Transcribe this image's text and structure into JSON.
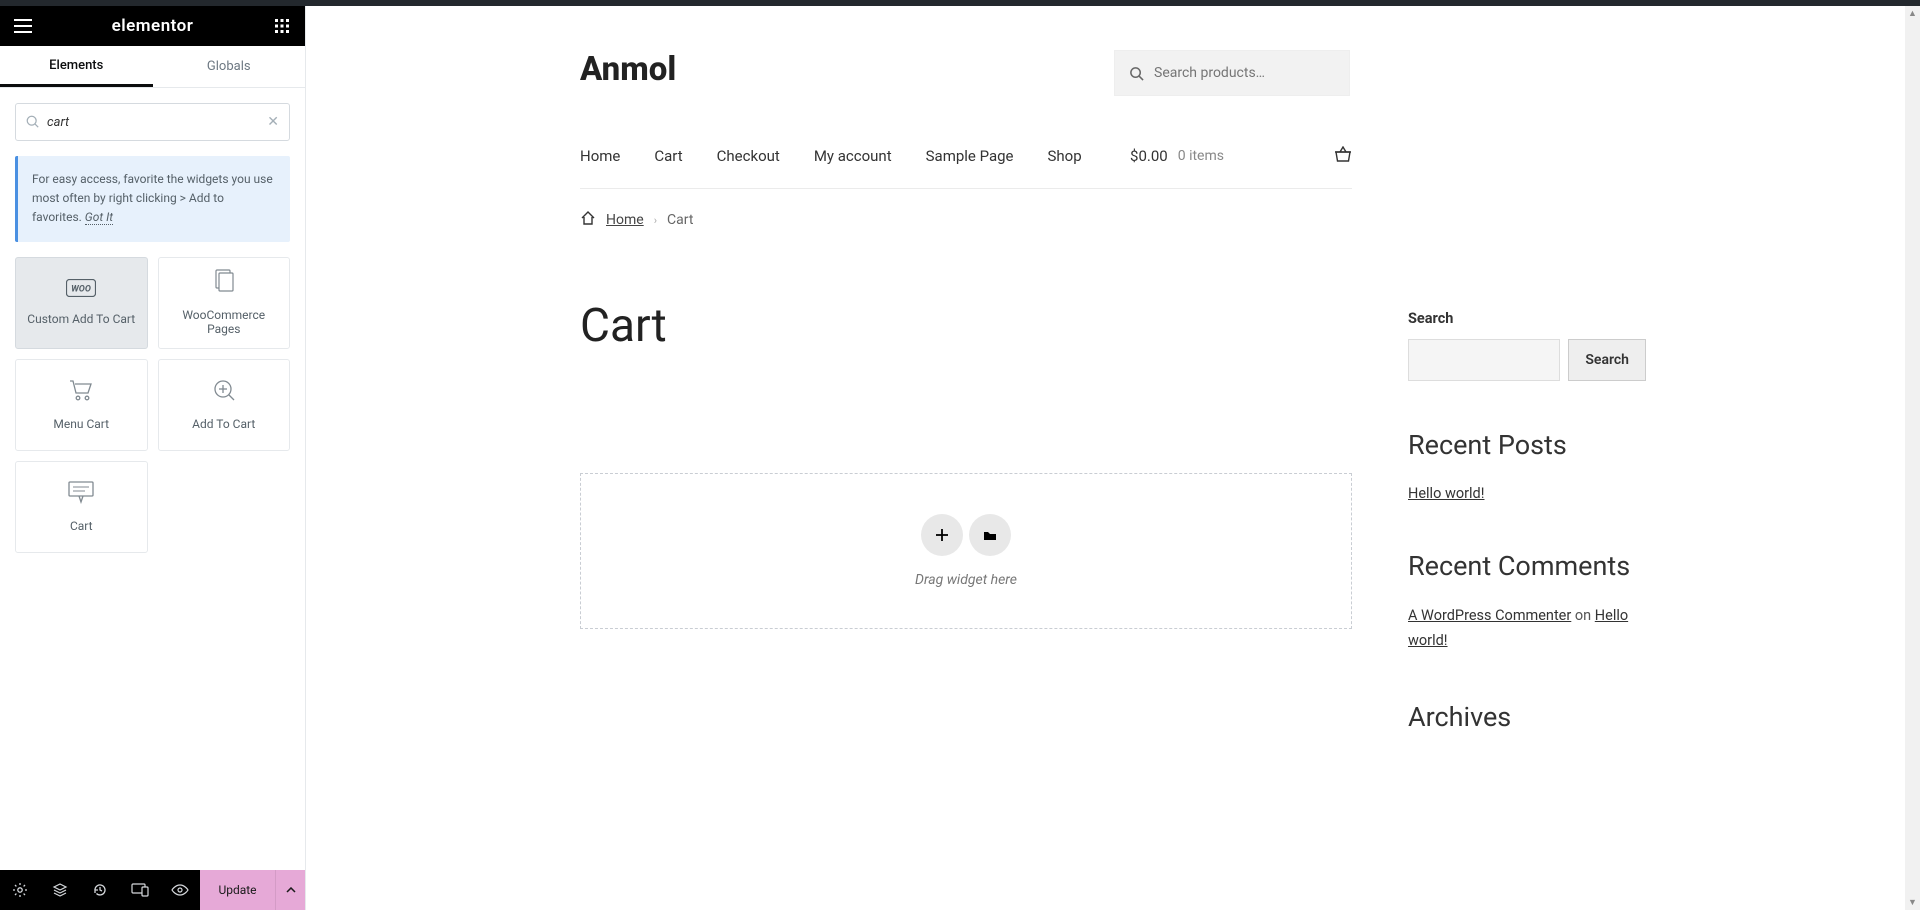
{
  "elementor": {
    "logo": "elementor",
    "tabs": {
      "elements": "Elements",
      "globals": "Globals"
    },
    "search_value": "cart",
    "tip": {
      "text": "For easy access, favorite the widgets you use most often by right clicking > Add to favorites.",
      "got_it": "Got It"
    },
    "widgets": [
      {
        "label": "Custom Add To Cart",
        "icon": "woo"
      },
      {
        "label": "WooCommerce Pages",
        "icon": "pages"
      },
      {
        "label": "Menu Cart",
        "icon": "cart"
      },
      {
        "label": "Add To Cart",
        "icon": "addcart"
      },
      {
        "label": "Cart",
        "icon": "cartpage"
      }
    ],
    "footer": {
      "update": "Update"
    }
  },
  "site": {
    "title": "Anmol",
    "search_placeholder": "Search products…",
    "nav": [
      "Home",
      "Cart",
      "Checkout",
      "My account",
      "Sample Page",
      "Shop"
    ],
    "cart": {
      "total": "$0.00",
      "items": "0 items"
    },
    "breadcrumb": {
      "home": "Home",
      "current": "Cart"
    },
    "page_title": "Cart",
    "dropzone_text": "Drag widget here",
    "sidebar": {
      "search_label": "Search",
      "search_button": "Search",
      "recent_posts_title": "Recent Posts",
      "recent_posts": [
        "Hello world!"
      ],
      "recent_comments_title": "Recent Comments",
      "recent_comment_author": "A WordPress Commenter",
      "recent_comment_on": " on ",
      "recent_comment_post": "Hello world!",
      "archives_title": "Archives"
    }
  }
}
